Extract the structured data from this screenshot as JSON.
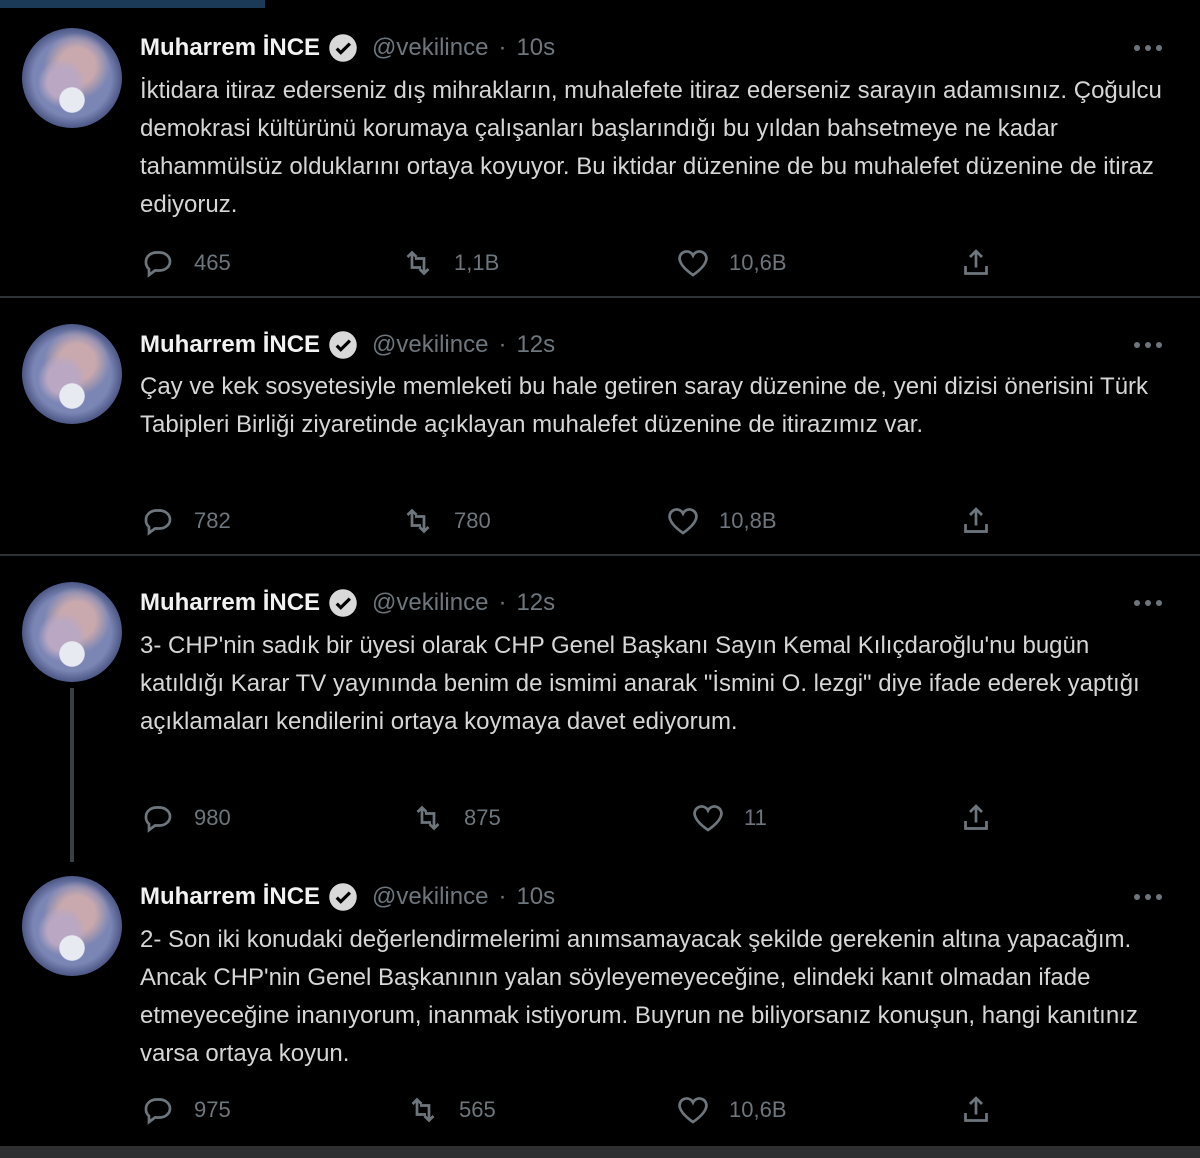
{
  "tweets": [
    {
      "name": "Muharrem İNCE",
      "handle": "@vekilince",
      "dot": "·",
      "time": "10s",
      "text": "İktidara itiraz ederseniz dış mihrakların, muhalefete itiraz ederseniz sarayın adamısınız. Çoğulcu demokrasi kültürünü korumaya çalışanları başlarındığı bu yıldan bahsetmeye ne kadar tahammülsüz olduklarını ortaya koyuyor. Bu iktidar düzenine de bu muhalefet düzenine de itiraz ediyoruz.",
      "replies": "465",
      "retweets": "1,1B",
      "likes": "10,6B"
    },
    {
      "name": "Muharrem İNCE",
      "handle": "@vekilince",
      "dot": "·",
      "time": "12s",
      "text": "Çay ve kek sosyetesiyle memleketi bu hale getiren saray düzenine de, yeni dizisi önerisini Türk Tabipleri Birliği ziyaretinde açıklayan muhalefet düzenine de itirazımız var.",
      "replies": "782",
      "retweets": "780",
      "likes": "10,8B"
    },
    {
      "name": "Muharrem İNCE",
      "handle": "@vekilince",
      "dot": "·",
      "time": "12s",
      "text": "3- CHP'nin sadık bir üyesi olarak CHP Genel Başkanı Sayın Kemal Kılıçdaroğlu'nu bugün katıldığı Karar TV yayınında benim de ismimi anarak \"İsmini O. lezgi\" diye ifade ederek yaptığı açıklamaları kendilerini ortaya koymaya davet ediyorum.",
      "replies": "980",
      "retweets": "875",
      "likes": "11"
    },
    {
      "name": "Muharrem İNCE",
      "handle": "@vekilince",
      "dot": "·",
      "time": "10s",
      "text": "2- Son iki konudaki değerlendirmelerimi anımsamayacak şekilde gerekenin altına yapacağım. Ancak CHP'nin Genel Başkanının yalan söyleyemeyeceğine, elindeki kanıt olmadan ifade etmeyeceğine inanıyorum, inanmak istiyorum. Buyrun ne biliyorsanız konuşun, hangi kanıtınız varsa ortaya koyun.",
      "replies": "975",
      "retweets": "565",
      "likes": "10,6B"
    }
  ],
  "colors": {
    "background": "#000000",
    "text": "#d9d9d9",
    "muted": "#6e767d",
    "separator": "#2f3336"
  },
  "icons": [
    "verified-badge-icon",
    "more-icon",
    "reply-icon",
    "retweet-icon",
    "like-icon",
    "share-icon"
  ]
}
